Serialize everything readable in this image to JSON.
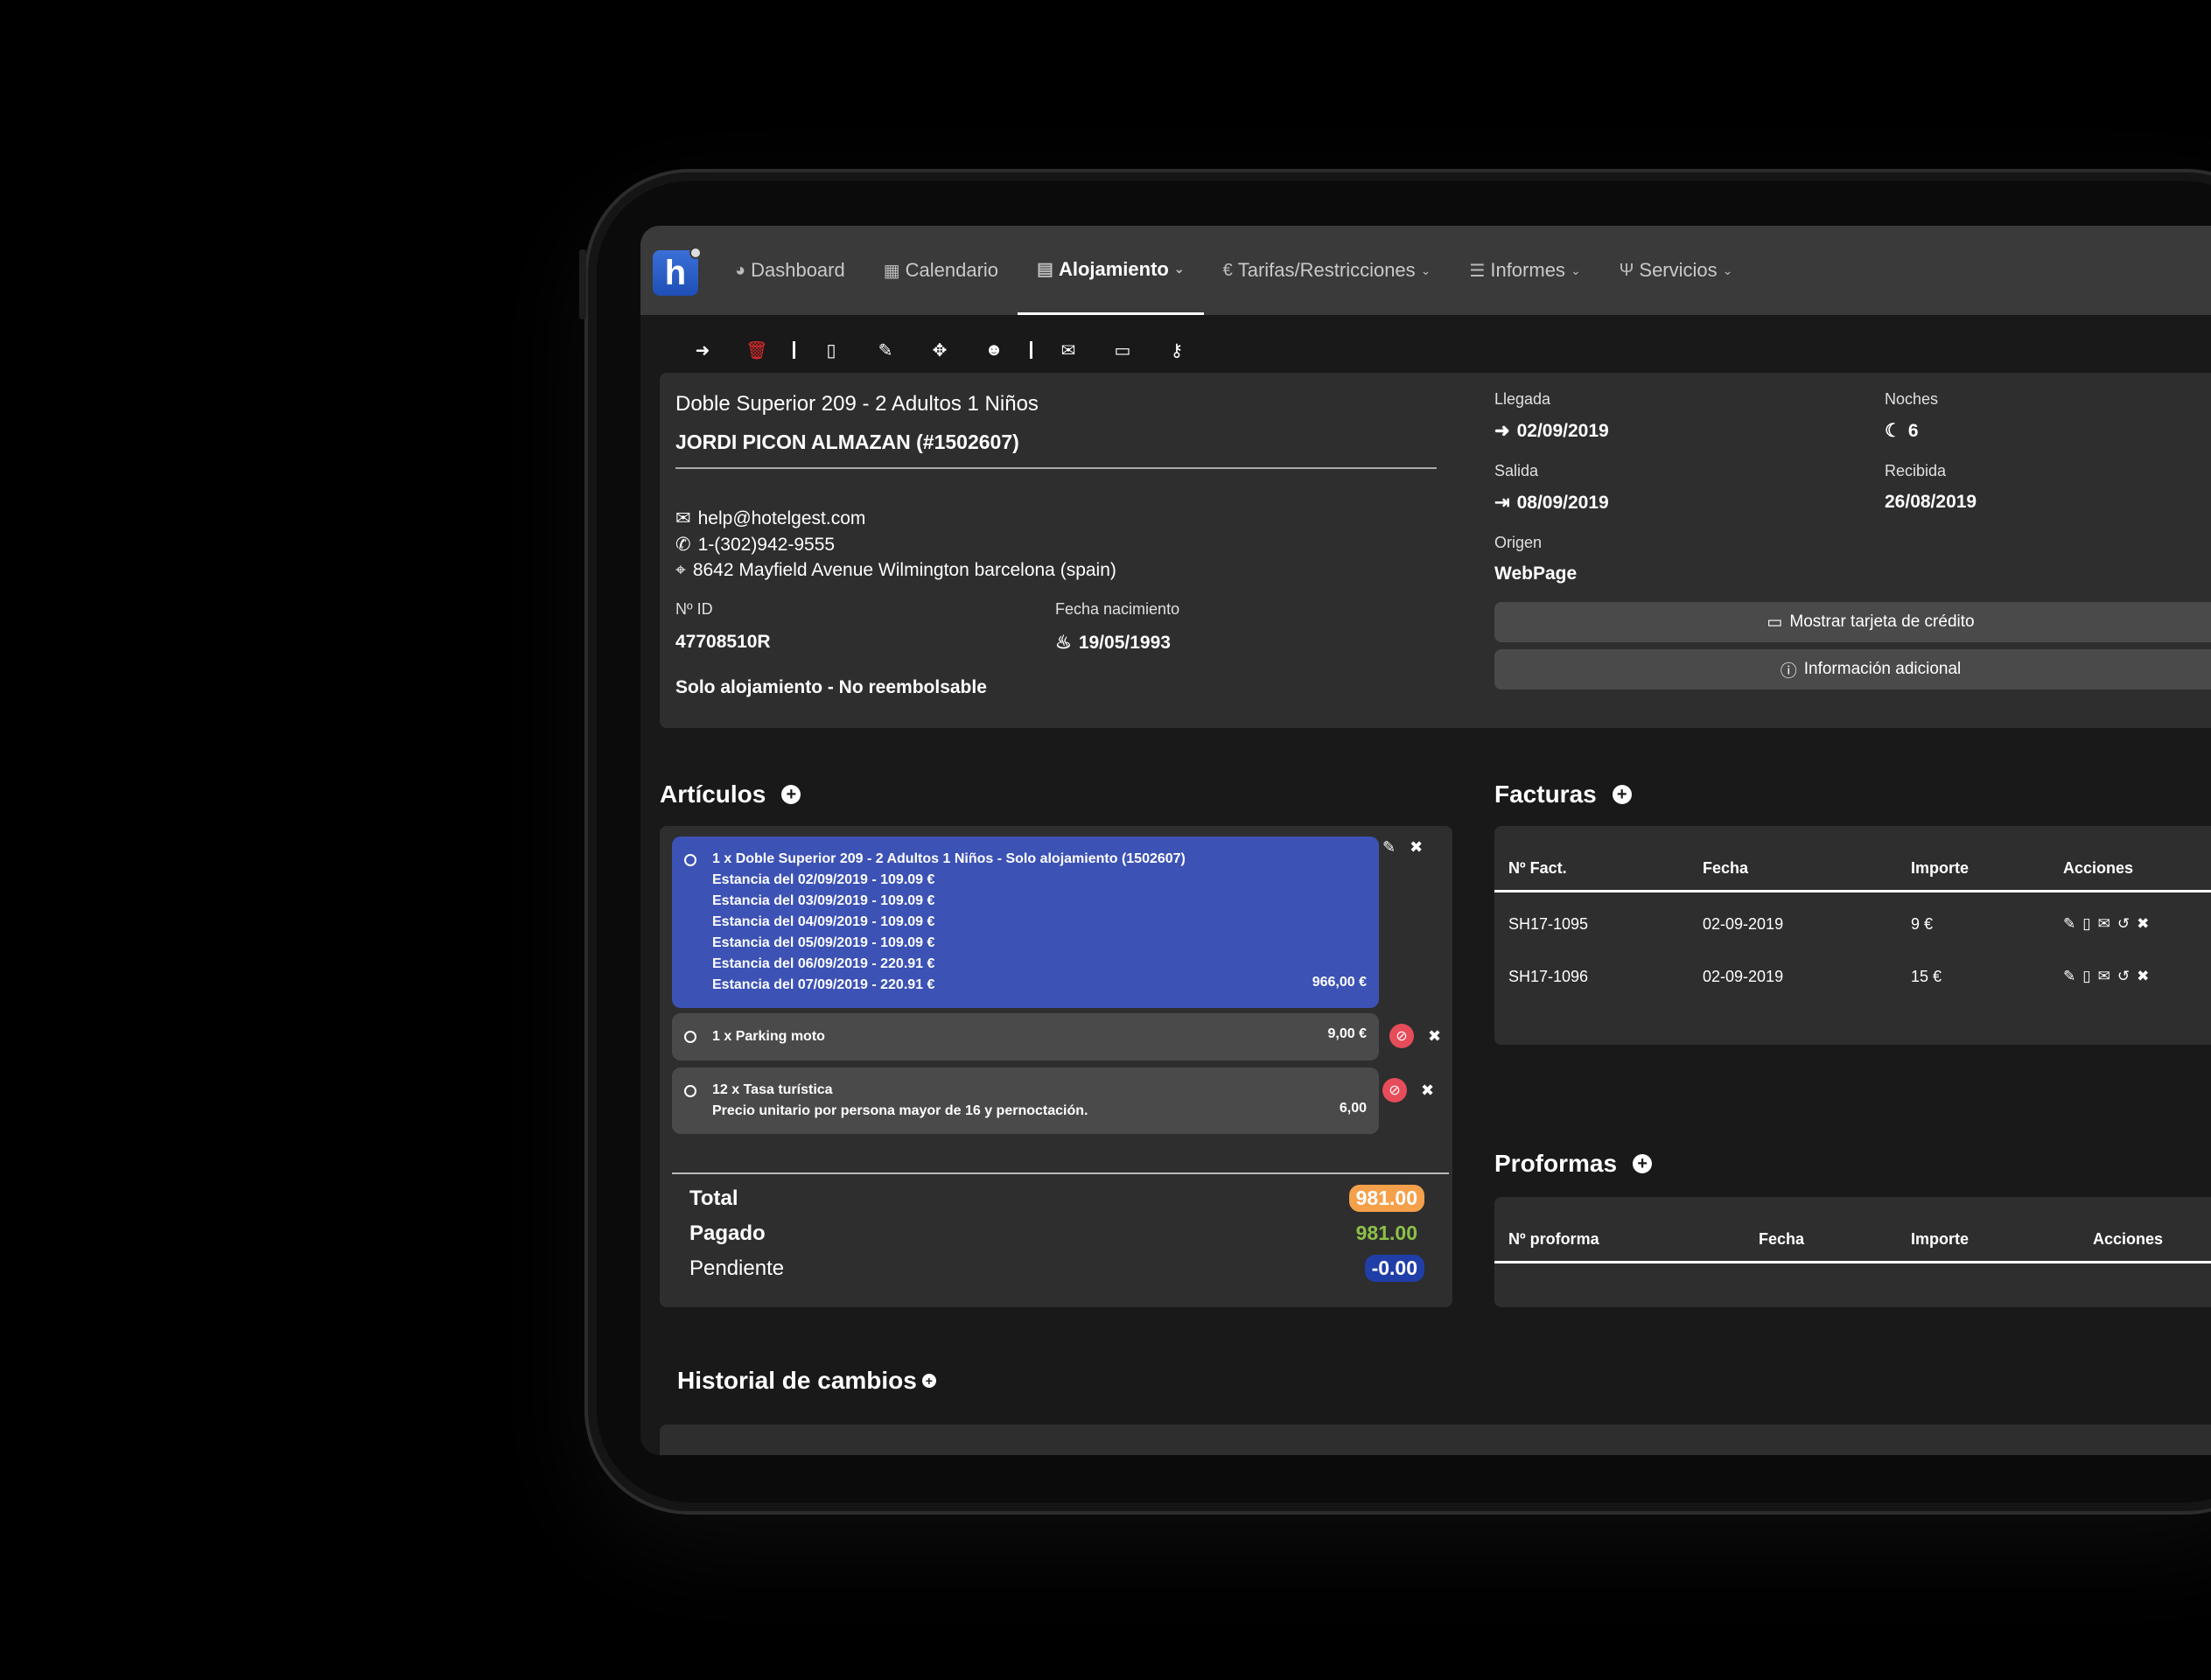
{
  "nav": {
    "items": [
      {
        "icon": "pie-chart-icon",
        "glyph": "◕",
        "label": "Dashboard",
        "chevron": false
      },
      {
        "icon": "calendar-icon",
        "glyph": "▦",
        "label": "Calendario",
        "chevron": false
      },
      {
        "icon": "building-icon",
        "glyph": "▤",
        "label": "Alojamiento",
        "chevron": true
      },
      {
        "icon": "euro-icon",
        "glyph": "€",
        "label": "Tarifas/Restricciones",
        "chevron": true
      },
      {
        "icon": "list-icon",
        "glyph": "☰",
        "label": "Informes",
        "chevron": true
      },
      {
        "icon": "cutlery-icon",
        "glyph": "Ψ",
        "label": "Servicios",
        "chevron": true
      }
    ],
    "active": "Alojamiento"
  },
  "toolbar": [
    "checkin-icon",
    "trash-icon",
    "pdf-icon",
    "edit-icon",
    "move-icon",
    "group-icon",
    "mail-icon",
    "card-icon",
    "key-icon"
  ],
  "guest": {
    "room": "Doble Superior 209 - 2 Adultos 1 Niños",
    "name": "JORDI PICON ALMAZAN (#1502607)",
    "email": "help@hotelgest.com",
    "phone": "1-(302)942-9555",
    "address": "8642 Mayfield Avenue Wilmington barcelona (spain)",
    "id_label": "Nº ID",
    "id_value": "47708510R",
    "birth_label": "Fecha nacimiento",
    "birth_value": "19/05/1993",
    "regime": "Solo alojamiento - No reembolsable"
  },
  "stay": {
    "arrival_label": "Llegada",
    "arrival_value": "02/09/2019",
    "nights_label": "Noches",
    "nights_value": "6",
    "departure_label": "Salida",
    "departure_value": "08/09/2019",
    "received_label": "Recibida",
    "received_value": "26/08/2019",
    "origin_label": "Origen",
    "origin_value": "WebPage",
    "card_button": "Mostrar tarjeta de crédito",
    "info_button": "Información adicional"
  },
  "articles": {
    "title": "Artículos",
    "items": [
      {
        "lines": [
          "1 x Doble Superior 209 - 2 Adultos 1 Niños - Solo alojamiento (1502607)",
          "Estancia del 02/09/2019 - 109.09 €",
          "Estancia del 03/09/2019 - 109.09 €",
          "Estancia del 04/09/2019 - 109.09 €",
          "Estancia del 05/09/2019 - 109.09 €",
          "Estancia del 06/09/2019 - 220.91 €",
          "Estancia del 07/09/2019 - 220.91 €"
        ],
        "price": "966,00 €"
      },
      {
        "lines": [
          "1 x Parking moto"
        ],
        "price": "9,00 €"
      },
      {
        "lines": [
          "12 x Tasa turística",
          "Precio unitario por persona mayor de 16 y pernoctación."
        ],
        "price": "6,00"
      }
    ],
    "total_label": "Total",
    "total_value": "981.00",
    "paid_label": "Pagado",
    "paid_value": "981.00",
    "pending_label": "Pendiente",
    "pending_value": "-0.00"
  },
  "invoices": {
    "title": "Facturas",
    "headers": [
      "Nº Fact.",
      "Fecha",
      "Importe",
      "Acciones"
    ],
    "rows": [
      [
        "SH17-1095",
        "02-09-2019",
        "9 €"
      ],
      [
        "SH17-1096",
        "02-09-2019",
        "15 €"
      ]
    ]
  },
  "proformas": {
    "title": "Proformas",
    "headers": [
      "Nº proforma",
      "Fecha",
      "Importe",
      "Acciones"
    ]
  },
  "history": {
    "title": "Historial de cambios"
  },
  "colors": {
    "selected_item": "#3c52b4",
    "total_badge": "#f5a04a",
    "paid_text": "#8cc048",
    "pending_badge": "#1f3ea8",
    "delete": "#e02b2b"
  }
}
